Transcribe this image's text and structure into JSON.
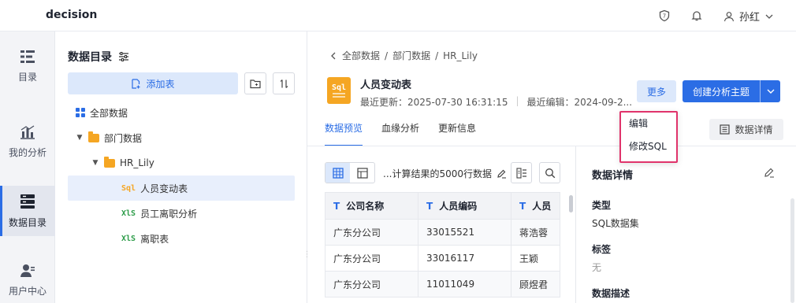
{
  "app": {
    "brand": "decision",
    "user_name": "孙红"
  },
  "rail": [
    {
      "label": "目录",
      "icon": "catalog-icon"
    },
    {
      "label": "我的分析",
      "icon": "chart-icon"
    },
    {
      "label": "数据目录",
      "icon": "database-icon",
      "active": true
    },
    {
      "label": "用户中心",
      "icon": "user-center-icon"
    }
  ],
  "tree": {
    "title": "数据目录",
    "add_label": "添加表",
    "items": [
      {
        "label": "全部数据"
      },
      {
        "label": "部门数据"
      },
      {
        "label": "HR_Lily"
      },
      {
        "label": "人员变动表",
        "tag": "Sql",
        "selected": true
      },
      {
        "label": "员工离职分析",
        "tag": "XlS"
      },
      {
        "label": "离职表",
        "tag": "XlS"
      }
    ]
  },
  "breadcrumb": [
    "全部数据",
    "部门数据",
    "HR_Lily"
  ],
  "dataset": {
    "icon_tag": "Sql",
    "title": "人员变动表",
    "last_update": "最近更新：2025-07-30 16:31:15",
    "last_edit": "最近编辑：2024-09-2..."
  },
  "actions": {
    "more": "更多",
    "create": "创建分析主题"
  },
  "dropdown": [
    "编辑",
    "修改SQL"
  ],
  "tabs": [
    {
      "label": "数据预览",
      "active": true
    },
    {
      "label": "血缘分析"
    },
    {
      "label": "更新信息"
    }
  ],
  "detail_button": "数据详情",
  "preview": {
    "calc_text": "...计算结果的5000行数据",
    "columns": [
      "公司名称",
      "人员编码",
      "人员"
    ],
    "rows": [
      [
        "广东分公司",
        "33015521",
        "蒋浩蓉"
      ],
      [
        "广东分公司",
        "33016117",
        "王颖"
      ],
      [
        "广东分公司",
        "11011049",
        "顾煜君"
      ]
    ]
  },
  "details": {
    "title": "数据详情",
    "type_label": "类型",
    "type_value": "SQL数据集",
    "tag_label": "标签",
    "tag_value": "无",
    "desc_label": "数据描述"
  }
}
